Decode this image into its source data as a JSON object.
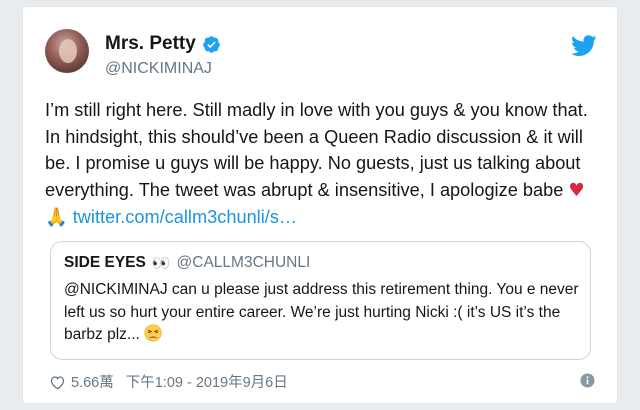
{
  "author": {
    "display_name": "Mrs. Petty",
    "handle": "@NICKIMINAJ"
  },
  "tweet": {
    "text": "I’m still right here. Still madly in love with you guys & you know that. In hindsight, this should’ve been a Queen Radio discussion & it will be. I promise u guys will be happy. No guests, just us talking about everything. The tweet was abrupt & insensitive, I apologize babe",
    "emoji_heart": "♥",
    "emoji_hands": "🙏",
    "link": "twitter.com/callm3chunli/s…"
  },
  "quoted": {
    "name": "SIDE EYES",
    "eyes_emoji": "👀",
    "handle": "@CALLM3CHUNLI",
    "text": "@NICKIMINAJ can u please just address this retirement thing. You e never left us so hurt your entire career. We’re just hurting Nicki :( it’s US it’s the barbz plz...",
    "emoji": "weary-face"
  },
  "footer": {
    "likes": "5.66萬",
    "timestamp": "下午1:09 - 2019年9月6日"
  },
  "colors": {
    "link": "#1b95e0",
    "verified": "#1da1f2",
    "muted": "#657786",
    "heart": "#d8283f"
  },
  "icons": [
    "twitter-bird-icon",
    "verified-badge-icon",
    "heart-outline-icon",
    "info-icon"
  ]
}
